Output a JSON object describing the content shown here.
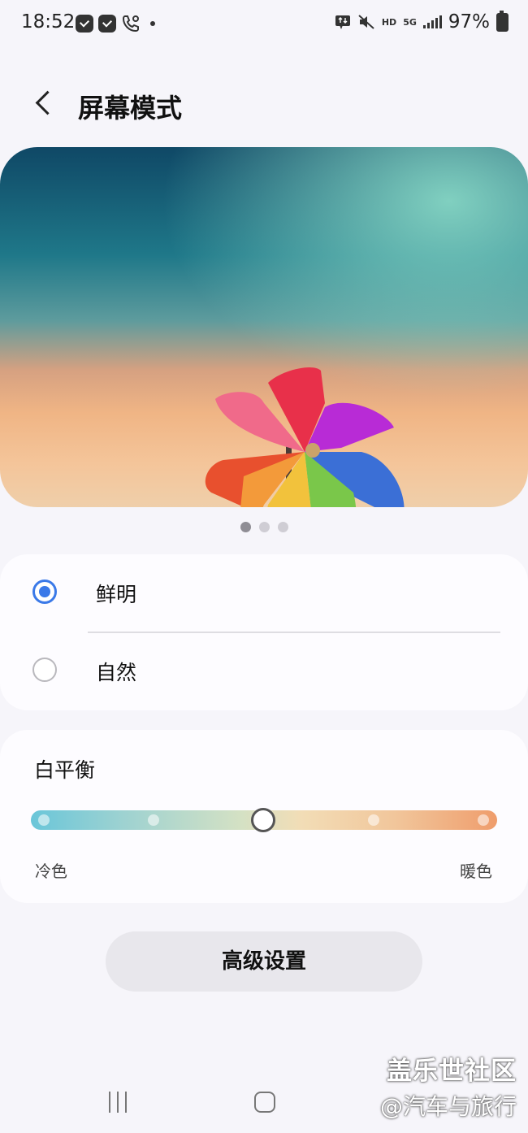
{
  "status_bar": {
    "time": "18:52",
    "network": "HD",
    "network_type": "5G",
    "battery_percent": "97%"
  },
  "header": {
    "title": "屏幕模式"
  },
  "preview": {
    "page_count": 3,
    "active_page": 1
  },
  "screen_mode": {
    "options": [
      {
        "label": "鲜明",
        "selected": true
      },
      {
        "label": "自然",
        "selected": false
      }
    ]
  },
  "white_balance": {
    "title": "白平衡",
    "min_label": "冷色",
    "max_label": "暖色",
    "steps": 5,
    "value_step": 3
  },
  "advanced": {
    "label": "高级设置"
  },
  "watermark": {
    "line1": "盖乐世社区",
    "line2": "@汽车与旅行"
  },
  "colors": {
    "accent": "#3a79e8",
    "background": "#f6f5fa",
    "card": "#fdfcff"
  }
}
